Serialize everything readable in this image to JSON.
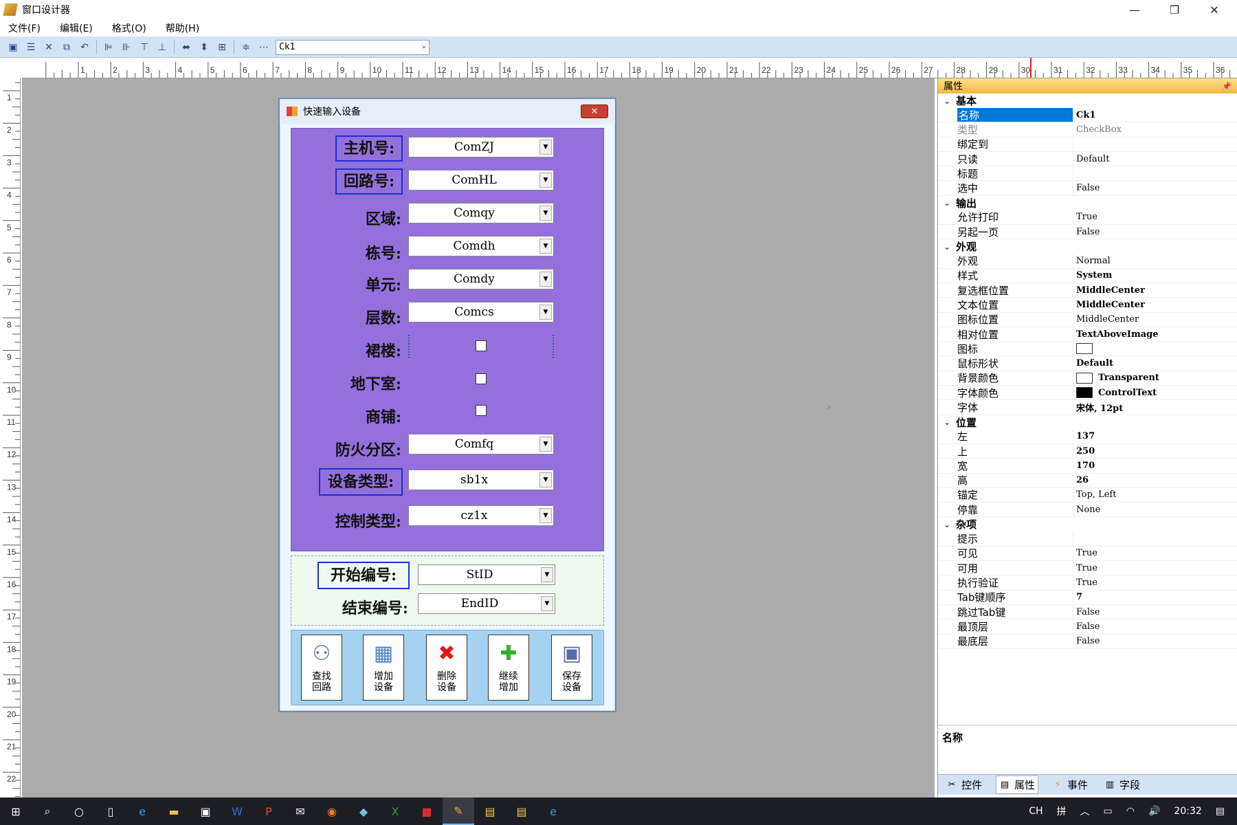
{
  "window": {
    "title": "窗口设计器",
    "min": "—",
    "restore": "❐",
    "close": "✕"
  },
  "menu": [
    "文件(F)",
    "编辑(E)",
    "格式(O)",
    "帮助(H)"
  ],
  "toolbar": {
    "combo_value": "Ck1"
  },
  "ruler": {
    "h": [
      "1",
      "2",
      "3",
      "4",
      "5",
      "6",
      "7",
      "8",
      "9",
      "10",
      "11",
      "12",
      "13",
      "14",
      "15",
      "16",
      "17",
      "18",
      "19",
      "20",
      "21",
      "22",
      "23",
      "24",
      "25",
      "26",
      "27",
      "28",
      "29",
      "30",
      "31",
      "32",
      "33",
      "34",
      "35",
      "36"
    ],
    "v": [
      "1",
      "2",
      "3",
      "4",
      "5",
      "6",
      "7",
      "8",
      "9",
      "10",
      "11",
      "12",
      "13",
      "14",
      "15",
      "16",
      "17",
      "18",
      "19",
      "20",
      "21",
      "22"
    ]
  },
  "dialog": {
    "title": "快速输入设备",
    "close": "✕",
    "fields": {
      "host": {
        "label": "主机号:",
        "value": "ComZJ"
      },
      "loop": {
        "label": "回路号:",
        "value": "ComHL"
      },
      "area": {
        "label": "区域:",
        "value": "Comqy"
      },
      "building": {
        "label": "栋号:",
        "value": "Comdh"
      },
      "unit": {
        "label": "单元:",
        "value": "Comdy"
      },
      "floor": {
        "label": "层数:",
        "value": "Comcs"
      },
      "podium": {
        "label": "裙楼:"
      },
      "basement": {
        "label": "地下室:"
      },
      "shop": {
        "label": "商铺:"
      },
      "firezone": {
        "label": "防火分区:",
        "value": "Comfq"
      },
      "devtype": {
        "label": "设备类型:",
        "value": "sb1x"
      },
      "ctrltype": {
        "label": "控制类型:",
        "value": "cz1x"
      },
      "startid": {
        "label": "开始编号:",
        "value": "StID"
      },
      "endid": {
        "label": "结束编号:",
        "value": "EndID"
      }
    },
    "buttons": [
      {
        "line1": "查找",
        "line2": "回路"
      },
      {
        "line1": "增加",
        "line2": "设备"
      },
      {
        "line1": "删除",
        "line2": "设备"
      },
      {
        "line1": "继续",
        "line2": "增加"
      },
      {
        "line1": "保存",
        "line2": "设备"
      }
    ]
  },
  "props": {
    "title": "属性",
    "cat_basic": "基本",
    "basic": [
      [
        "名称",
        "Ck1"
      ],
      [
        "类型",
        "CheckBox"
      ],
      [
        "绑定到",
        ""
      ],
      [
        "只读",
        "Default"
      ],
      [
        "标题",
        ""
      ],
      [
        "选中",
        "False"
      ]
    ],
    "cat_output": "输出",
    "output": [
      [
        "允许打印",
        "True"
      ],
      [
        "另起一页",
        "False"
      ]
    ],
    "cat_appear": "外观",
    "appear": [
      [
        "外观",
        "Normal"
      ],
      [
        "样式",
        "System"
      ],
      [
        "复选框位置",
        "MiddleCenter"
      ],
      [
        "文本位置",
        "MiddleCenter"
      ],
      [
        "图标位置",
        "MiddleCenter"
      ],
      [
        "相对位置",
        "TextAboveImage"
      ],
      [
        "图标",
        ""
      ],
      [
        "鼠标形状",
        "Default"
      ],
      [
        "背景颜色",
        "Transparent"
      ],
      [
        "字体颜色",
        "ControlText"
      ],
      [
        "字体",
        "宋体, 12pt"
      ]
    ],
    "cat_pos": "位置",
    "pos": [
      [
        "左",
        "137"
      ],
      [
        "上",
        "250"
      ],
      [
        "宽",
        "170"
      ],
      [
        "高",
        "26"
      ],
      [
        "锚定",
        "Top, Left"
      ],
      [
        "停靠",
        "None"
      ]
    ],
    "cat_misc": "杂项",
    "misc": [
      [
        "提示",
        ""
      ],
      [
        "可见",
        "True"
      ],
      [
        "可用",
        "True"
      ],
      [
        "执行验证",
        "True"
      ],
      [
        "Tab键顺序",
        "7"
      ],
      [
        "跳过Tab键",
        "False"
      ],
      [
        "最顶层",
        "False"
      ],
      [
        "最底层",
        "False"
      ]
    ],
    "desc": "名称",
    "tabs": [
      "控件",
      "属性",
      "事件",
      "字段"
    ]
  },
  "taskbar": {
    "ime1": "CH",
    "ime2": "拼",
    "time": "20:32"
  },
  "colors": {
    "purple": "#9370db",
    "accent": "#0078d7"
  }
}
